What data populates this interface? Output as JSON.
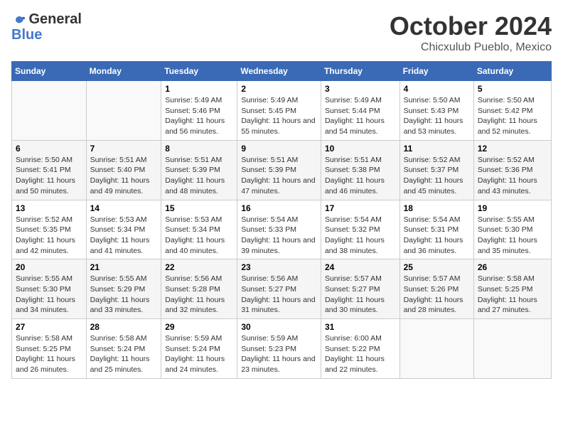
{
  "logo": {
    "general": "General",
    "blue": "Blue"
  },
  "title": "October 2024",
  "subtitle": "Chicxulub Pueblo, Mexico",
  "header_days": [
    "Sunday",
    "Monday",
    "Tuesday",
    "Wednesday",
    "Thursday",
    "Friday",
    "Saturday"
  ],
  "weeks": [
    [
      {
        "day": "",
        "info": ""
      },
      {
        "day": "",
        "info": ""
      },
      {
        "day": "1",
        "info": "Sunrise: 5:49 AM\nSunset: 5:46 PM\nDaylight: 11 hours and 56 minutes."
      },
      {
        "day": "2",
        "info": "Sunrise: 5:49 AM\nSunset: 5:45 PM\nDaylight: 11 hours and 55 minutes."
      },
      {
        "day": "3",
        "info": "Sunrise: 5:49 AM\nSunset: 5:44 PM\nDaylight: 11 hours and 54 minutes."
      },
      {
        "day": "4",
        "info": "Sunrise: 5:50 AM\nSunset: 5:43 PM\nDaylight: 11 hours and 53 minutes."
      },
      {
        "day": "5",
        "info": "Sunrise: 5:50 AM\nSunset: 5:42 PM\nDaylight: 11 hours and 52 minutes."
      }
    ],
    [
      {
        "day": "6",
        "info": "Sunrise: 5:50 AM\nSunset: 5:41 PM\nDaylight: 11 hours and 50 minutes."
      },
      {
        "day": "7",
        "info": "Sunrise: 5:51 AM\nSunset: 5:40 PM\nDaylight: 11 hours and 49 minutes."
      },
      {
        "day": "8",
        "info": "Sunrise: 5:51 AM\nSunset: 5:39 PM\nDaylight: 11 hours and 48 minutes."
      },
      {
        "day": "9",
        "info": "Sunrise: 5:51 AM\nSunset: 5:39 PM\nDaylight: 11 hours and 47 minutes."
      },
      {
        "day": "10",
        "info": "Sunrise: 5:51 AM\nSunset: 5:38 PM\nDaylight: 11 hours and 46 minutes."
      },
      {
        "day": "11",
        "info": "Sunrise: 5:52 AM\nSunset: 5:37 PM\nDaylight: 11 hours and 45 minutes."
      },
      {
        "day": "12",
        "info": "Sunrise: 5:52 AM\nSunset: 5:36 PM\nDaylight: 11 hours and 43 minutes."
      }
    ],
    [
      {
        "day": "13",
        "info": "Sunrise: 5:52 AM\nSunset: 5:35 PM\nDaylight: 11 hours and 42 minutes."
      },
      {
        "day": "14",
        "info": "Sunrise: 5:53 AM\nSunset: 5:34 PM\nDaylight: 11 hours and 41 minutes."
      },
      {
        "day": "15",
        "info": "Sunrise: 5:53 AM\nSunset: 5:34 PM\nDaylight: 11 hours and 40 minutes."
      },
      {
        "day": "16",
        "info": "Sunrise: 5:54 AM\nSunset: 5:33 PM\nDaylight: 11 hours and 39 minutes."
      },
      {
        "day": "17",
        "info": "Sunrise: 5:54 AM\nSunset: 5:32 PM\nDaylight: 11 hours and 38 minutes."
      },
      {
        "day": "18",
        "info": "Sunrise: 5:54 AM\nSunset: 5:31 PM\nDaylight: 11 hours and 36 minutes."
      },
      {
        "day": "19",
        "info": "Sunrise: 5:55 AM\nSunset: 5:30 PM\nDaylight: 11 hours and 35 minutes."
      }
    ],
    [
      {
        "day": "20",
        "info": "Sunrise: 5:55 AM\nSunset: 5:30 PM\nDaylight: 11 hours and 34 minutes."
      },
      {
        "day": "21",
        "info": "Sunrise: 5:55 AM\nSunset: 5:29 PM\nDaylight: 11 hours and 33 minutes."
      },
      {
        "day": "22",
        "info": "Sunrise: 5:56 AM\nSunset: 5:28 PM\nDaylight: 11 hours and 32 minutes."
      },
      {
        "day": "23",
        "info": "Sunrise: 5:56 AM\nSunset: 5:27 PM\nDaylight: 11 hours and 31 minutes."
      },
      {
        "day": "24",
        "info": "Sunrise: 5:57 AM\nSunset: 5:27 PM\nDaylight: 11 hours and 30 minutes."
      },
      {
        "day": "25",
        "info": "Sunrise: 5:57 AM\nSunset: 5:26 PM\nDaylight: 11 hours and 28 minutes."
      },
      {
        "day": "26",
        "info": "Sunrise: 5:58 AM\nSunset: 5:25 PM\nDaylight: 11 hours and 27 minutes."
      }
    ],
    [
      {
        "day": "27",
        "info": "Sunrise: 5:58 AM\nSunset: 5:25 PM\nDaylight: 11 hours and 26 minutes."
      },
      {
        "day": "28",
        "info": "Sunrise: 5:58 AM\nSunset: 5:24 PM\nDaylight: 11 hours and 25 minutes."
      },
      {
        "day": "29",
        "info": "Sunrise: 5:59 AM\nSunset: 5:24 PM\nDaylight: 11 hours and 24 minutes."
      },
      {
        "day": "30",
        "info": "Sunrise: 5:59 AM\nSunset: 5:23 PM\nDaylight: 11 hours and 23 minutes."
      },
      {
        "day": "31",
        "info": "Sunrise: 6:00 AM\nSunset: 5:22 PM\nDaylight: 11 hours and 22 minutes."
      },
      {
        "day": "",
        "info": ""
      },
      {
        "day": "",
        "info": ""
      }
    ]
  ]
}
